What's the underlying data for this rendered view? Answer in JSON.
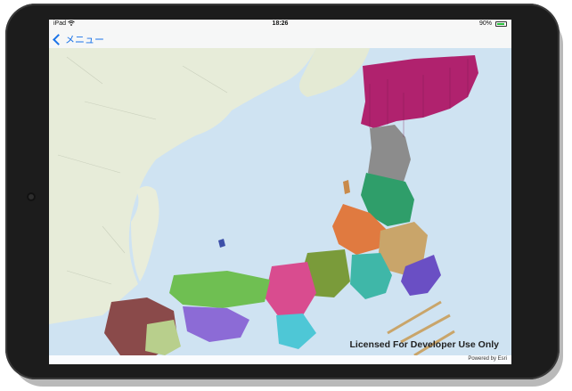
{
  "status_bar": {
    "device": "iPad",
    "time": "18:26",
    "battery_percent": "90%",
    "battery_level": 0.9,
    "battery_color": "#27c23b"
  },
  "nav": {
    "back_label": "メニュー",
    "accent_color": "#1a73e8"
  },
  "map": {
    "watermark": "Licensed For Developer Use Only",
    "attribution": "Powered by Esri",
    "icons": [
      "wifi-icon",
      "battery-icon",
      "chevron-left-icon"
    ]
  }
}
